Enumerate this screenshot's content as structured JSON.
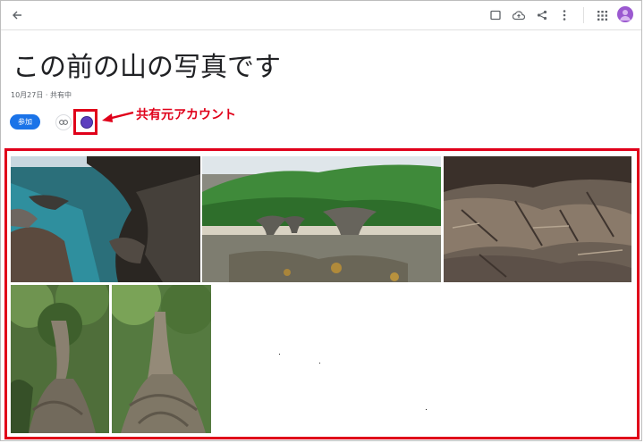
{
  "toolbar": {
    "back": "back-arrow-icon",
    "icons": [
      "select-icon",
      "cloud-upload-icon",
      "share-icon",
      "more-vert-icon",
      "apps-grid-icon",
      "account-avatar"
    ]
  },
  "album": {
    "title": "この前の山の写真です",
    "meta": "10月27日 · 共有中",
    "join_label": "参加"
  },
  "annotation": {
    "label": "共有元アカウント",
    "color": "#e0001a"
  },
  "photos": [
    {
      "subject": "rocky-coast-cave"
    },
    {
      "subject": "mushroom-rocks-green-hill"
    },
    {
      "subject": "weathered-rock-face"
    },
    {
      "subject": "jungle-banyan-tree-1"
    },
    {
      "subject": "jungle-banyan-tree-2"
    }
  ],
  "colors": {
    "accent": "#1a73e8",
    "highlight": "#e0001a",
    "avatar": "#9b59d0"
  }
}
